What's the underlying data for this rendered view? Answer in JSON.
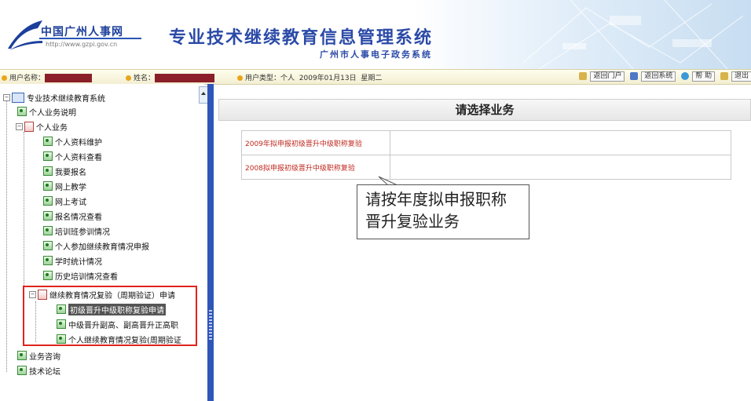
{
  "header": {
    "logo_text": "中国广州人事网",
    "logo_url": "http://www.gzpi.gov.cn",
    "system_title": "专业技术继续教育信息管理系统",
    "system_subtitle": "广州市人事电子政务系统"
  },
  "infobar": {
    "username_label": "用户名称：",
    "name_label": "姓名：",
    "usertype_label": "用户类型：",
    "usertype_value": "个人",
    "date": "2009年01月13日",
    "weekday": "星期二",
    "buttons": {
      "back_portal": "返回门户",
      "back_system": "返回系统",
      "help": "帮 助",
      "logout": "退出"
    }
  },
  "tree": {
    "root": "专业技术继续教育系统",
    "items": [
      "个人业务说明",
      "个人业务",
      "个人资料维护",
      "个人资料查看",
      "我要报名",
      "网上教学",
      "网上考试",
      "报名情况查看",
      "培训班参训情况",
      "个人参加继续教育情况申报",
      "学时统计情况",
      "历史培训情况查看",
      "继续教育情况复验（周期验证）申请",
      "初级晋升中级职称复验申请",
      "中级晋升副高、副高晋升正高职",
      "个人继续教育情况复验(周期验证",
      "业务咨询",
      "技术论坛"
    ]
  },
  "main": {
    "title": "请选择业务",
    "rows": [
      {
        "label": "2009年拟申报初级晋升中级职称复验"
      },
      {
        "label": "2008拟申报初级晋升中级职称复验"
      }
    ],
    "callout": "请按年度拟申报职称晋升复验业务"
  },
  "colors": {
    "brand_blue": "#2b4aa8",
    "link_red": "#c0281f",
    "highlight_red": "#e0241c"
  }
}
